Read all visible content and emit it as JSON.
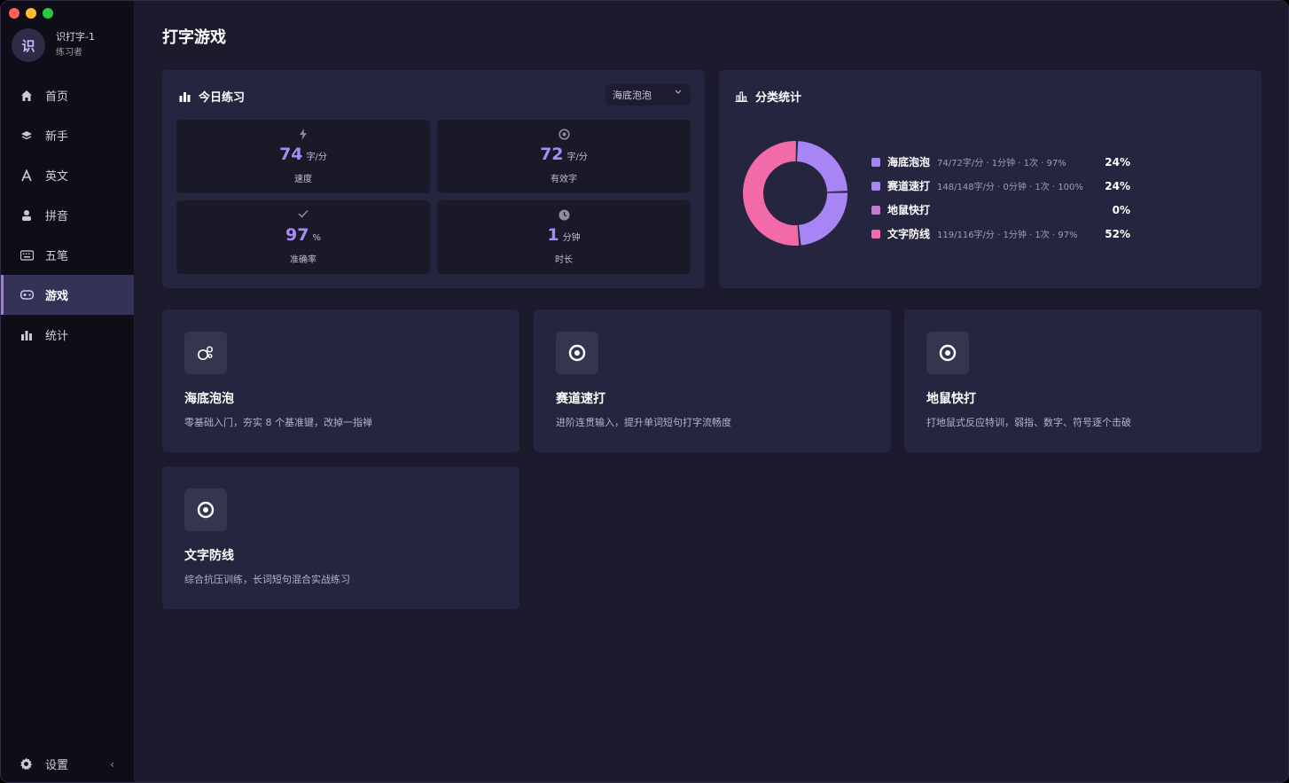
{
  "app": {
    "avatar_char": "识",
    "user_name": "识打字-1",
    "user_role": "练习者"
  },
  "nav": {
    "items": [
      {
        "label": "首页",
        "icon": "home-icon"
      },
      {
        "label": "新手",
        "icon": "layers-icon"
      },
      {
        "label": "英文",
        "icon": "letter-a-icon"
      },
      {
        "label": "拼音",
        "icon": "user-icon"
      },
      {
        "label": "五笔",
        "icon": "keyboard-icon"
      },
      {
        "label": "游戏",
        "icon": "gamepad-icon",
        "active": true
      },
      {
        "label": "统计",
        "icon": "bar-chart-icon"
      }
    ],
    "settings_label": "设置",
    "collapse_glyph": "‹"
  },
  "page": {
    "title": "打字游戏"
  },
  "today": {
    "title": "今日练习",
    "selected_game": "海底泡泡",
    "stats": [
      {
        "value": "74",
        "unit": "字/分",
        "label": "速度",
        "icon": "bolt-icon"
      },
      {
        "value": "72",
        "unit": "字/分",
        "label": "有效字",
        "icon": "target-icon"
      },
      {
        "value": "97",
        "unit": "%",
        "label": "准确率",
        "icon": "check-icon"
      },
      {
        "value": "1",
        "unit": "分钟",
        "label": "时长",
        "icon": "clock-icon"
      }
    ]
  },
  "categories": {
    "title": "分类统计",
    "colors": {
      "海底泡泡": "#a885f5",
      "赛道速打": "#a885f5",
      "地鼠快打": "#c57ad8",
      "文字防线": "#f26aa8"
    }
  },
  "chart_data": {
    "type": "pie",
    "categories": [
      "海底泡泡",
      "赛道速打",
      "地鼠快打",
      "文字防线"
    ],
    "values": [
      24,
      24,
      0,
      52
    ],
    "details": [
      "74/72字/分 · 1分钟 · 1次 · 97%",
      "148/148字/分 · 0分钟 · 1次 · 100%",
      "",
      "119/116字/分 · 1分钟 · 1次 · 97%"
    ],
    "labels": [
      "24%",
      "24%",
      "0%",
      "52%"
    ],
    "colors": [
      "#a885f5",
      "#a885f5",
      "#c57ad8",
      "#f26aa8"
    ]
  },
  "games": [
    {
      "title": "海底泡泡",
      "desc": "零基础入门，夯实 8 个基准键，改掉一指禅",
      "icon": "bubbles-icon"
    },
    {
      "title": "赛道速打",
      "desc": "进阶连贯输入，提升单词短句打字流畅度",
      "icon": "target-icon"
    },
    {
      "title": "地鼠快打",
      "desc": "打地鼠式反应特训，弱指、数字、符号逐个击破",
      "icon": "target-icon"
    },
    {
      "title": "文字防线",
      "desc": "综合抗压训练，长词短句混合实战练习",
      "icon": "target-icon"
    }
  ]
}
